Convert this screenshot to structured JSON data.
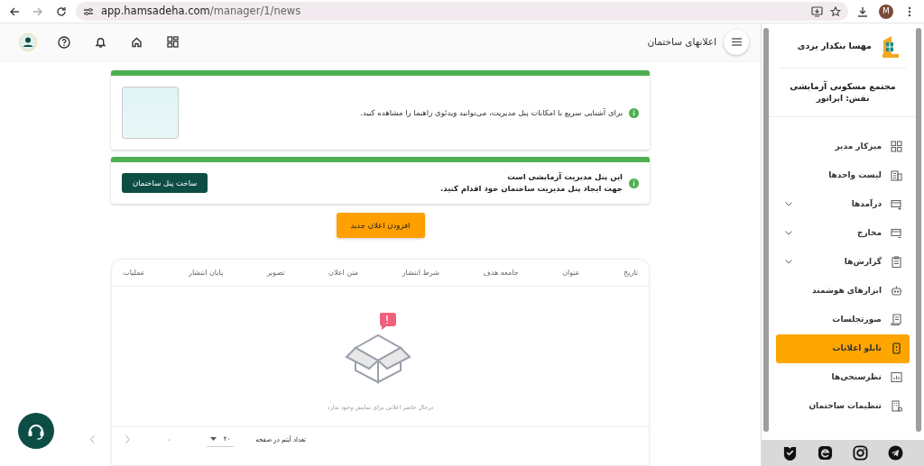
{
  "browser": {
    "url_host": "app.hamsadeha.com",
    "url_path": "/manager/1/news",
    "profile_initial": "M"
  },
  "header": {
    "title": "اعلانهای ساختمان"
  },
  "guide_card": {
    "text": "برای آشنایی سریع با امکانات پنل مدیریت، می‌توانید ویدئوی راهنما را مشاهده کنید."
  },
  "trial_card": {
    "title": "این پنل مدیریت آزمایشی است",
    "text": "جهت ایجاد پنل مدیریت ساختمان خود اقدام کنید.",
    "button": "ساخت پنل ساختمان"
  },
  "add_button": "افزودن اعلان جدید",
  "table": {
    "columns": [
      "تاریخ",
      "عنوان",
      "جامعه هدف",
      "شرط انتشار",
      "متن اعلان",
      "تصویر",
      "پایان انتشار",
      "عملیات"
    ],
    "empty_message": "درحال حاضر اعلانی برای نمایش وجود ندارد",
    "footer": {
      "page_size_label": "تعداد آیتم در صفحه",
      "page_size": "۲۰",
      "range": "-"
    }
  },
  "sidebar": {
    "user_name": "مهسا بنکدار یزدی",
    "complex_name": "مجتمع مسکونی آزمایشی",
    "role": "نقش: اپراتور",
    "items": [
      {
        "label": "میزکار مدیر",
        "expandable": false,
        "selected": false
      },
      {
        "label": "لیست واحدها",
        "expandable": false,
        "selected": false
      },
      {
        "label": "درآمدها",
        "expandable": true,
        "selected": false
      },
      {
        "label": "مخارج",
        "expandable": true,
        "selected": false
      },
      {
        "label": "گزارش‌ها",
        "expandable": true,
        "selected": false
      },
      {
        "label": "ابزارهای هوشمند",
        "expandable": false,
        "selected": false
      },
      {
        "label": "صورتجلسات",
        "expandable": false,
        "selected": false
      },
      {
        "label": "تابلو اعلانات",
        "expandable": false,
        "selected": true
      },
      {
        "label": "نظرسنجی‌ها",
        "expandable": false,
        "selected": false
      },
      {
        "label": "تنظیمات ساختمان",
        "expandable": false,
        "selected": false
      }
    ]
  }
}
